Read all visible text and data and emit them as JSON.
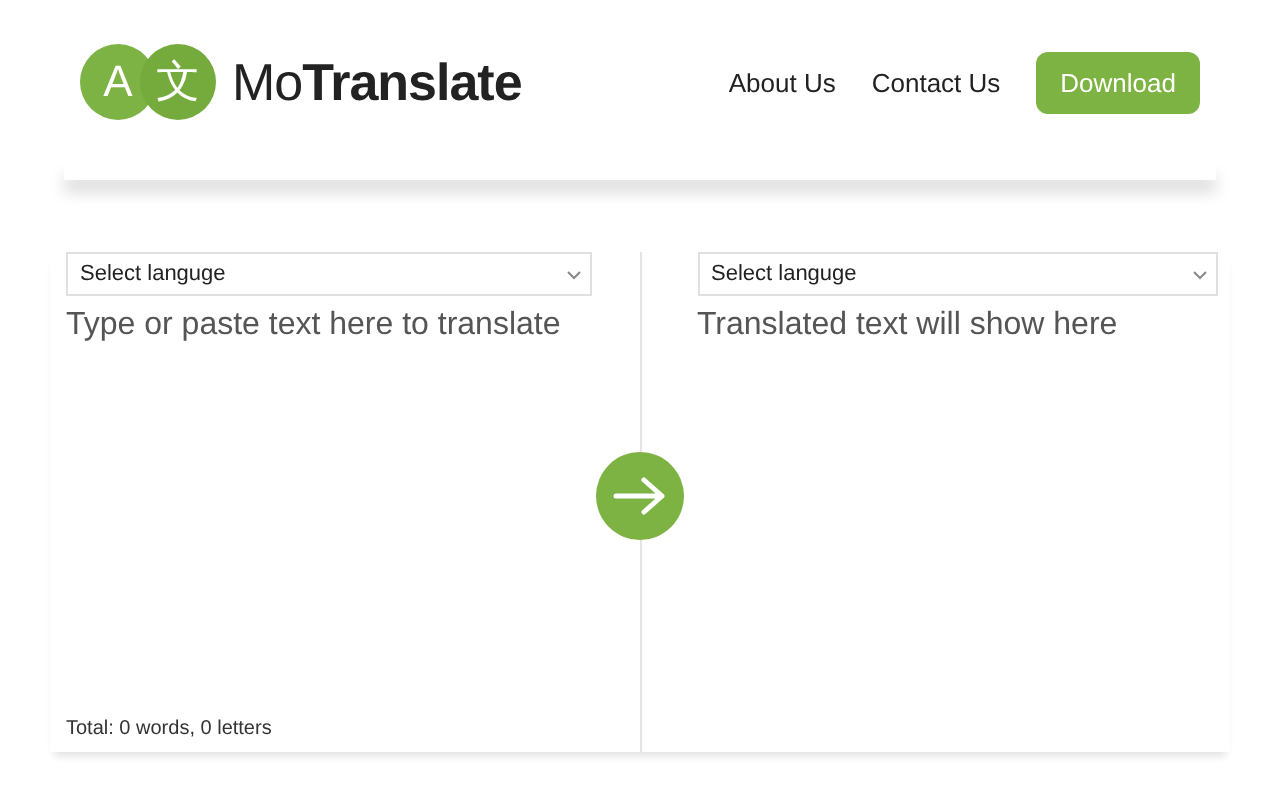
{
  "header": {
    "logo": {
      "glyphs": [
        "A",
        "文"
      ],
      "name_parts": [
        "Mo",
        "Translate"
      ]
    },
    "nav": [
      {
        "label": "About Us",
        "kind": "link"
      },
      {
        "label": "Contact Us",
        "kind": "link"
      },
      {
        "label": "Download",
        "kind": "button"
      }
    ]
  },
  "source": {
    "language_select": "Select languge",
    "placeholder": "Type or paste text here to translate",
    "counter": "Total: 0 words, 0 letters"
  },
  "target": {
    "language_select": "Select languge",
    "placeholder": "Translated text will show here"
  }
}
